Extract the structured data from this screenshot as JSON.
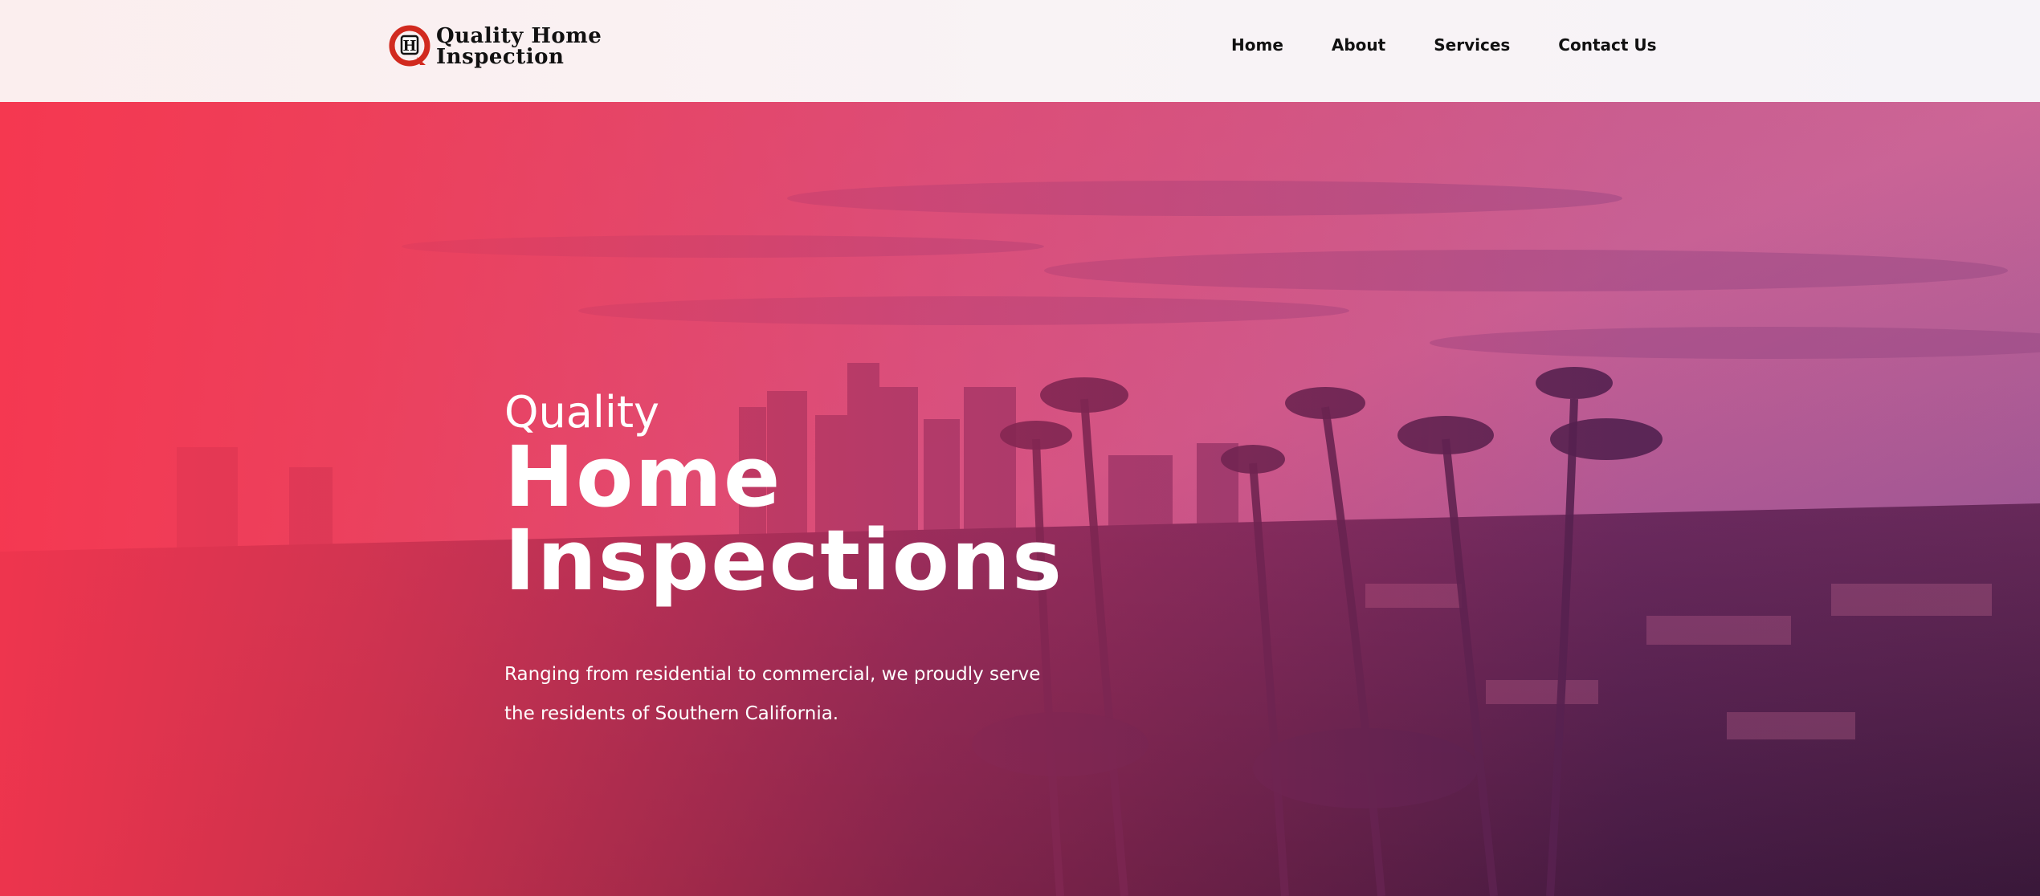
{
  "brand": {
    "line1": "Quality Home",
    "line2": "Inspection",
    "logo_letter": "H",
    "logo_color": "#d12a1f"
  },
  "nav": {
    "items": [
      "Home",
      "About",
      "Services",
      "Contact Us"
    ]
  },
  "hero": {
    "kicker": "Quality",
    "title_line1": "Home",
    "title_line2": "Inspections",
    "description": "Ranging from residential to commercial, we proudly serve the residents of Southern California.",
    "overlay_color": "#f6364e"
  }
}
